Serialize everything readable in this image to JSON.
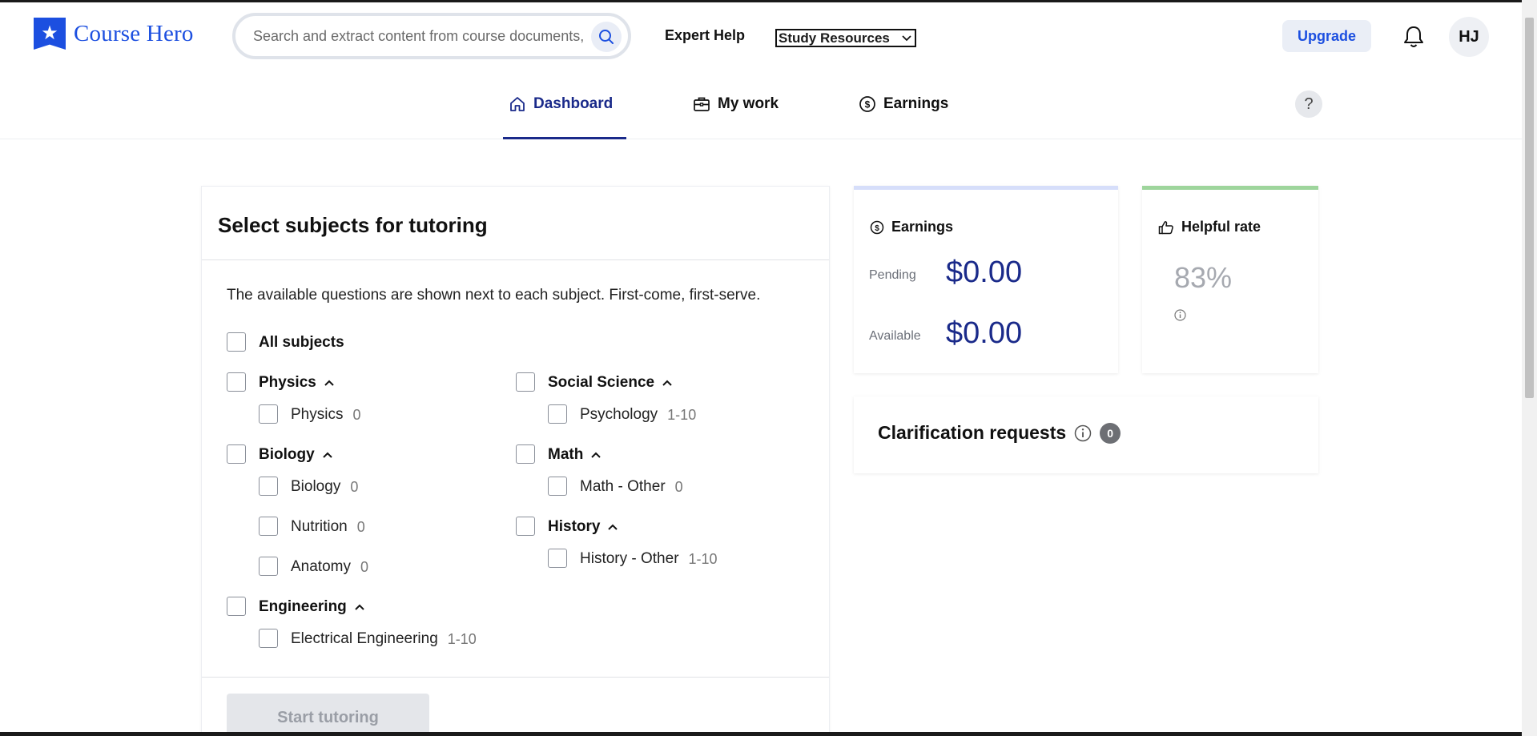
{
  "header": {
    "logo_text": "Course Hero",
    "search_placeholder": "Search and extract content from course documents, ",
    "expert_help": "Expert Help",
    "study_resources": "Study Resources",
    "upgrade": "Upgrade",
    "avatar_initials": "HJ"
  },
  "subnav": {
    "tabs": [
      {
        "label": "Dashboard",
        "icon": "home-icon",
        "active": true
      },
      {
        "label": "My work",
        "icon": "briefcase-icon"
      },
      {
        "label": "Earnings",
        "icon": "dollar-icon"
      }
    ],
    "help_glyph": "?"
  },
  "subjects": {
    "title": "Select subjects for tutoring",
    "description": "The available questions are shown next to each subject. First-come, first-serve.",
    "all_label": "All subjects",
    "groups": [
      {
        "name": "Physics",
        "items": [
          {
            "label": "Physics",
            "count": "0"
          }
        ]
      },
      {
        "name": "Biology",
        "items": [
          {
            "label": "Biology",
            "count": "0"
          },
          {
            "label": "Nutrition",
            "count": "0"
          },
          {
            "label": "Anatomy",
            "count": "0"
          }
        ]
      },
      {
        "name": "Engineering",
        "items": [
          {
            "label": "Electrical Engineering",
            "count": "1-10"
          }
        ]
      },
      {
        "name": "Social Science",
        "items": [
          {
            "label": "Psychology",
            "count": "1-10"
          }
        ]
      },
      {
        "name": "Math",
        "items": [
          {
            "label": "Math - Other",
            "count": "0"
          }
        ]
      },
      {
        "name": "History",
        "items": [
          {
            "label": "History - Other",
            "count": "1-10"
          }
        ]
      }
    ],
    "start_button": "Start tutoring"
  },
  "earnings": {
    "title": "Earnings",
    "pending_label": "Pending",
    "pending_value": "$0.00",
    "available_label": "Available",
    "available_value": "$0.00"
  },
  "helpful": {
    "title": "Helpful rate",
    "value": "83%"
  },
  "clarification": {
    "title": "Clarification requests",
    "count": "0"
  },
  "colors": {
    "brand": "#1c4fe0",
    "active_tab": "#1a2a8a",
    "earnings_accent": "#d6defa",
    "helpful_accent": "#9ed59c"
  }
}
